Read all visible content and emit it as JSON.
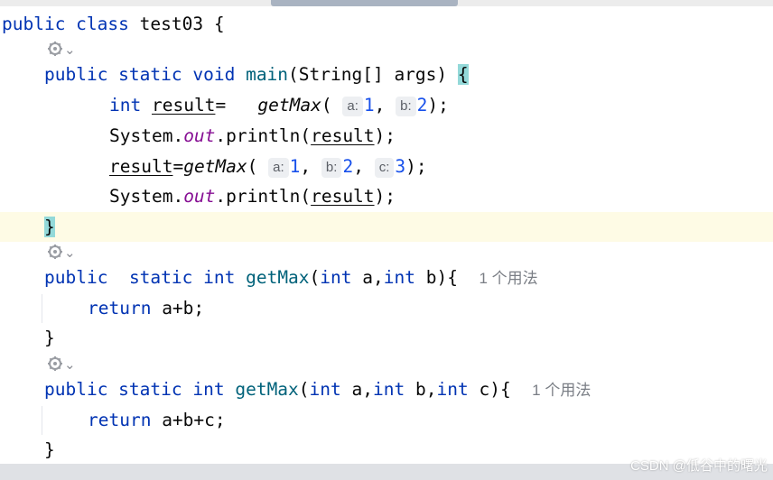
{
  "code": {
    "class_kw": "public class",
    "class_name": "test03",
    "open_brace": " {",
    "main": {
      "mods": "public static void",
      "name": "main",
      "params_a": "(String[] args) ",
      "brace": "{"
    },
    "line_int_result": {
      "type": "int",
      "var": "result",
      "eq": "=  ",
      "call": "getMax",
      "paren": "(",
      "hint_a": "a:",
      "arg1": "1",
      "comma": ",",
      "hint_b": "b:",
      "arg2": "2",
      "close": ");"
    },
    "println1": {
      "obj": "System.",
      "field": "out",
      "method": ".println(",
      "var": "result",
      "close": ");"
    },
    "line_result3": {
      "var": "result",
      "eq": "=",
      "call": "getMax",
      "paren": "(",
      "hint_a": "a:",
      "arg1": "1",
      "comma1": ",",
      "hint_b": "b:",
      "arg2": "2",
      "comma2": ",",
      "hint_c": "c:",
      "arg3": "3",
      "close": ");"
    },
    "println2": {
      "obj": "System.",
      "field": "out",
      "method": ".println(",
      "var": "result",
      "close": ");"
    },
    "main_close": "}",
    "getmax2": {
      "kw1": "public",
      "kw2": "static int",
      "name": "getMax",
      "p1": "(",
      "int1": "int",
      "pa": " a,",
      "int2": "int",
      "pb": " b){",
      "usage": "1 个用法",
      "ret": "return",
      "expr": " a+b;",
      "close": "}"
    },
    "getmax3": {
      "mods": "public static int",
      "name": "getMax",
      "p1": "(",
      "int1": "int",
      "pa": " a,",
      "int2": "int",
      "pb": " b,",
      "int3": "int",
      "pc": " c){",
      "usage": "1 个用法",
      "ret": "return",
      "expr": " a+b+c;",
      "close": "}"
    }
  },
  "gutter": {
    "marker_icon": "run-gear-icon",
    "chevron": "⌄"
  },
  "watermark": "CSDN @低谷中的曙光",
  "colors": {
    "keyword": "#0033b3",
    "function": "#00627a",
    "number": "#1750eb",
    "field": "#871094",
    "current_line": "#fefbe5",
    "brace_match": "#93d9d9"
  }
}
